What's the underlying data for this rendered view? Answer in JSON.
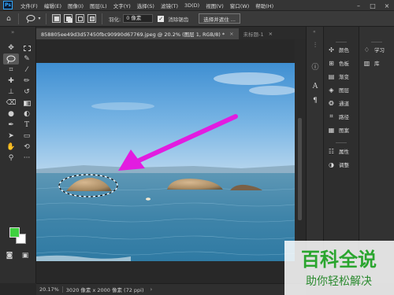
{
  "app": {
    "logo": "Ps"
  },
  "menu": [
    "文件(F)",
    "编辑(E)",
    "图像(I)",
    "图层(L)",
    "文字(Y)",
    "选择(S)",
    "滤镜(T)",
    "3D(D)",
    "视图(V)",
    "窗口(W)",
    "帮助(H)"
  ],
  "options_bar": {
    "feather_label": "羽化:",
    "feather_value": "0 像素",
    "antialias_label": "消除锯齿",
    "antialias_checked": true,
    "select_mask_button": "选择并遮住 ..."
  },
  "tabs": [
    {
      "label": "858805ee49d3d57450fbc90990d67769.jpeg @ 20.2% (图层 1, RGB/8) *",
      "close": "×"
    },
    {
      "label": "未标题-1",
      "close": "×"
    }
  ],
  "status": {
    "zoom": "20.17%",
    "doc_info": "3020 像素 x 2000 像素 (72 ppi)"
  },
  "colors": {
    "foreground": "#3fd13f",
    "background": "#ffffff",
    "arrow": "#e21ce0"
  },
  "panels": {
    "group1": [
      {
        "icon": "color-icon",
        "label": "颜色"
      },
      {
        "icon": "swatches-icon",
        "label": "色板"
      },
      {
        "icon": "gradient-icon",
        "label": "渐变"
      },
      {
        "icon": "layers-icon",
        "label": "图层"
      },
      {
        "icon": "channels-icon",
        "label": "通道"
      },
      {
        "icon": "paths-icon",
        "label": "路径"
      },
      {
        "icon": "patterns-icon",
        "label": "图案"
      }
    ],
    "group2": [
      {
        "icon": "properties-icon",
        "label": "属性"
      },
      {
        "icon": "adjustments-icon",
        "label": "调整"
      }
    ],
    "learn": {
      "icon": "bulb-icon",
      "label": "学习"
    },
    "libraries": {
      "icon": "library-icon",
      "label": "库"
    }
  },
  "watermark": {
    "line1": "百科全说",
    "line2": "助你轻松解决"
  }
}
